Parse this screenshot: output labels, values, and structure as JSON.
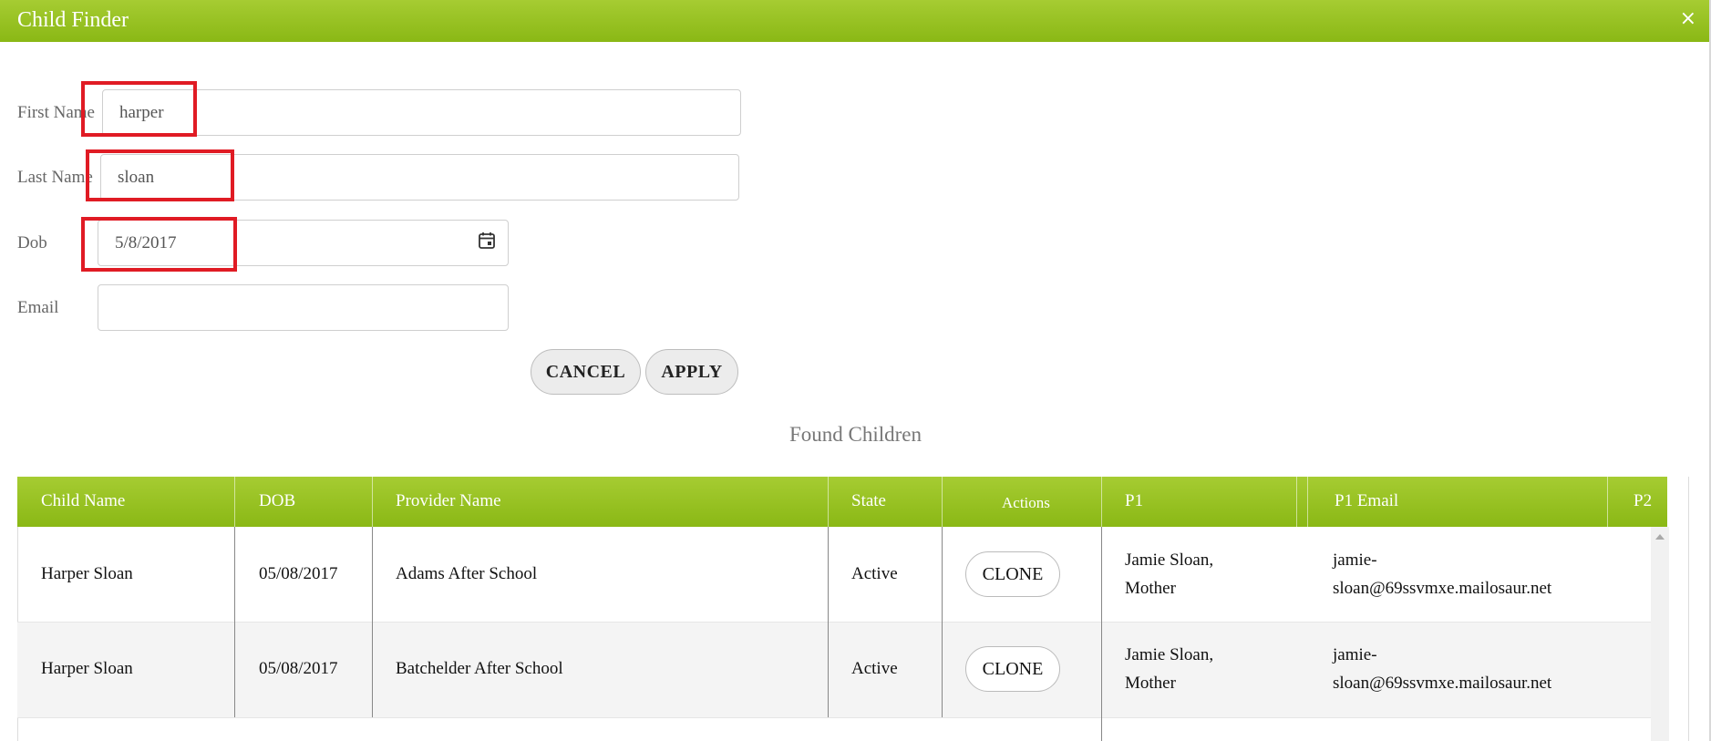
{
  "window": {
    "title": "Child Finder",
    "close_glyph": "×"
  },
  "form": {
    "first_name": {
      "label": "First Name",
      "value": "harper"
    },
    "last_name": {
      "label": "Last Name",
      "value": "sloan"
    },
    "dob": {
      "label": "Dob",
      "value": "5/8/2017",
      "icon": "calendar-icon"
    },
    "email": {
      "label": "Email",
      "value": ""
    },
    "cancel_label": "CANCEL",
    "apply_label": "APPLY"
  },
  "results": {
    "title": "Found Children",
    "columns": [
      "Child Name",
      "DOB",
      "Provider Name",
      "State",
      "Actions",
      "P1",
      "P1 Email",
      "P2"
    ],
    "rows": [
      {
        "child_name": "Harper Sloan",
        "dob": "05/08/2017",
        "provider": "Adams After School",
        "state": "Active",
        "action": "CLONE",
        "p1_name": "Jamie Sloan,",
        "p1_relation": "Mother",
        "p1_email_1": "jamie-",
        "p1_email_2": "sloan@69ssvmxe.mailosaur.net"
      },
      {
        "child_name": "Harper Sloan",
        "dob": "05/08/2017",
        "provider": "Batchelder After School",
        "state": "Active",
        "action": "CLONE",
        "p1_name": "Jamie Sloan,",
        "p1_relation": "Mother",
        "p1_email_1": "jamie-",
        "p1_email_2": "sloan@69ssvmxe.mailosaur.net"
      }
    ]
  },
  "colors": {
    "header_green_top": "#a6cc32",
    "header_green_bottom": "#8ab815",
    "highlight_red": "#e01b24",
    "alt_row": "#f4f4f4"
  }
}
